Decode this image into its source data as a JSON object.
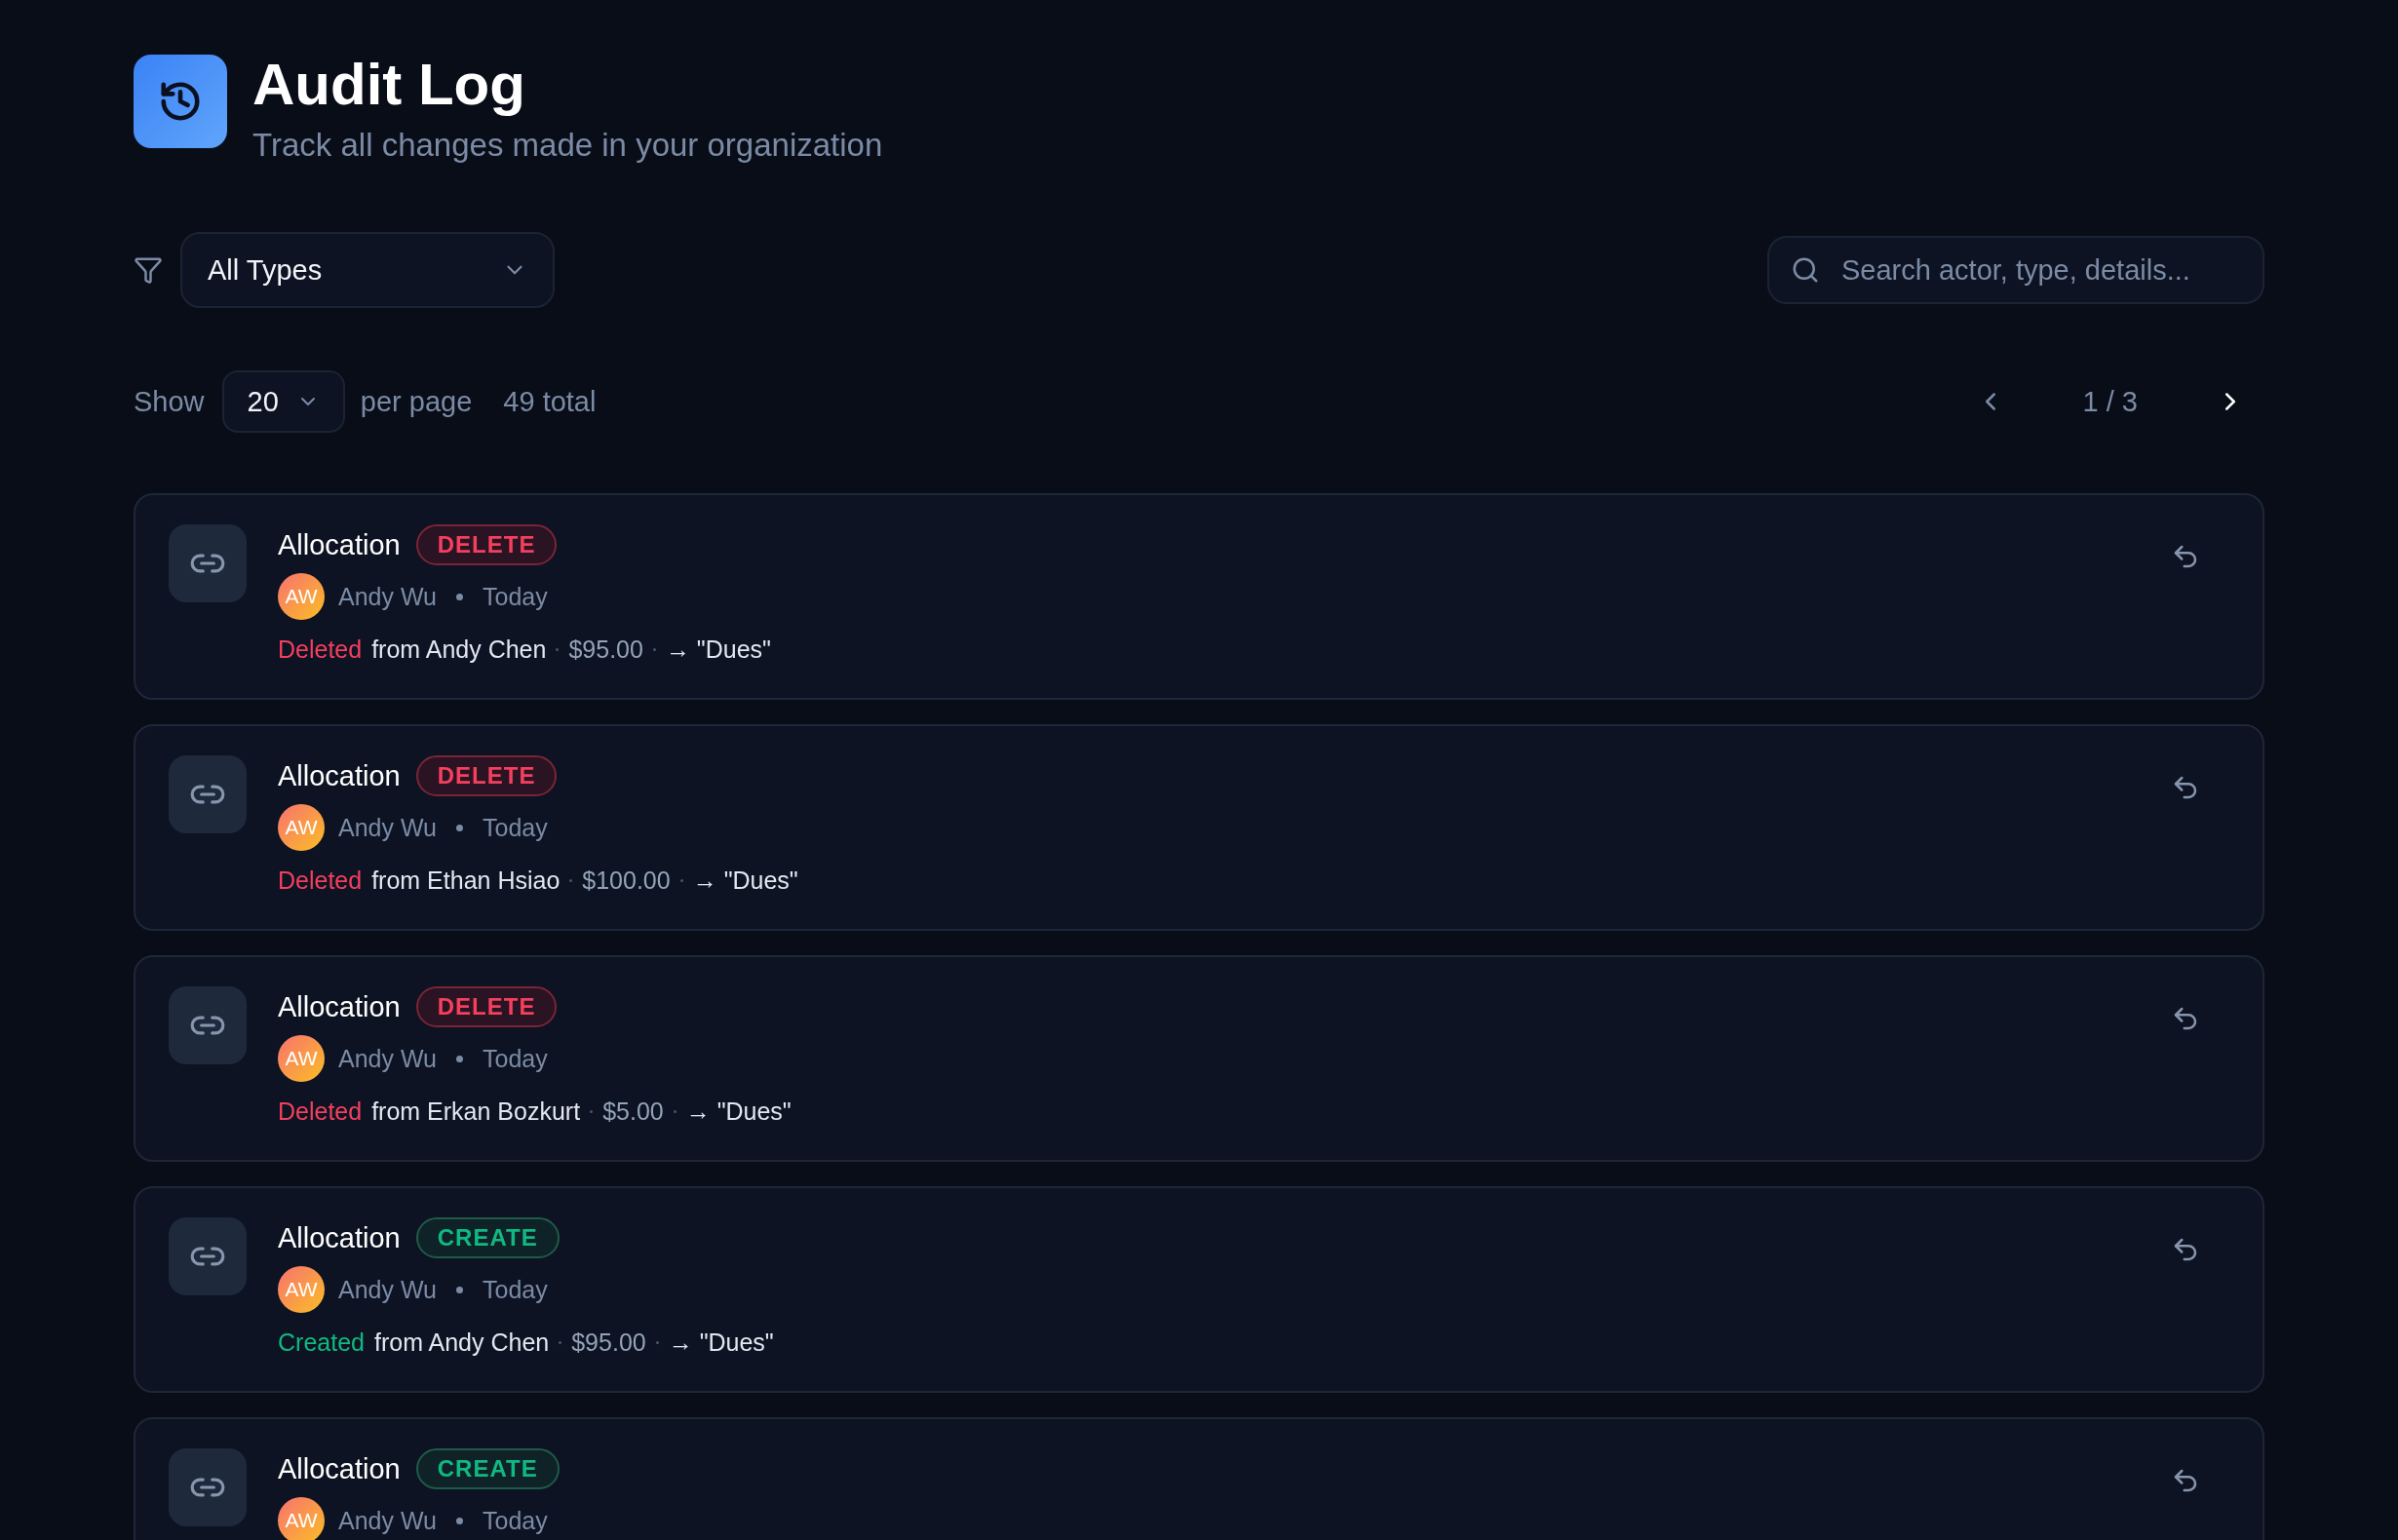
{
  "header": {
    "title": "Audit Log",
    "subtitle": "Track all changes made in your organization"
  },
  "filters": {
    "type_select": "All Types",
    "search": {
      "placeholder": "Search actor, type, details..."
    }
  },
  "paging": {
    "show_label": "Show",
    "page_size": "20",
    "per_page_label": "per page",
    "total": "49 total",
    "page": "1 / 3"
  },
  "entries": [
    {
      "entity": "Allocation",
      "action": "DELETE",
      "kind": "delete",
      "avatar": "AW",
      "actor": "Andy Wu",
      "time": "Today",
      "verb": "Deleted",
      "source": "from Andy Chen",
      "amount": "$95.00",
      "target": "→ \"Dues\""
    },
    {
      "entity": "Allocation",
      "action": "DELETE",
      "kind": "delete",
      "avatar": "AW",
      "actor": "Andy Wu",
      "time": "Today",
      "verb": "Deleted",
      "source": "from Ethan Hsiao",
      "amount": "$100.00",
      "target": "→ \"Dues\""
    },
    {
      "entity": "Allocation",
      "action": "DELETE",
      "kind": "delete",
      "avatar": "AW",
      "actor": "Andy Wu",
      "time": "Today",
      "verb": "Deleted",
      "source": "from Erkan Bozkurt",
      "amount": "$5.00",
      "target": "→ \"Dues\""
    },
    {
      "entity": "Allocation",
      "action": "CREATE",
      "kind": "create",
      "avatar": "AW",
      "actor": "Andy Wu",
      "time": "Today",
      "verb": "Created",
      "source": "from Andy Chen",
      "amount": "$95.00",
      "target": "→ \"Dues\""
    },
    {
      "entity": "Allocation",
      "action": "CREATE",
      "kind": "create",
      "avatar": "AW",
      "actor": "Andy Wu",
      "time": "Today"
    }
  ]
}
